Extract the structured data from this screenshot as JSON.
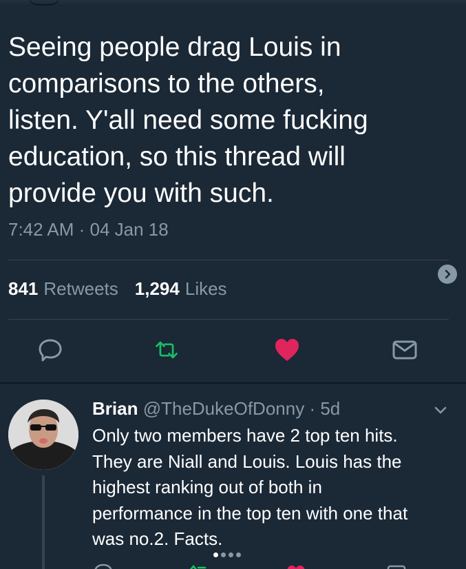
{
  "tweet": {
    "text": "Seeing people drag Louis in\ncomparisons to the others,\nlisten. Y'all need some fucking\neducation, so this thread will\nprovide you with such.",
    "timestamp": "7:42 AM · 04 Jan 18",
    "retweets_count": "841",
    "retweets_label": "Retweets",
    "likes_count": "1,294",
    "likes_label": "Likes"
  },
  "icons": {
    "reply": "speech-bubble-icon",
    "retweet": "retweet-icon",
    "like": "heart-icon",
    "dm": "envelope-icon",
    "expand": "chevron-right-icon"
  },
  "colors": {
    "background": "#1b2836",
    "secondary_text": "#8899a6",
    "retweet_green": "#17bf63",
    "like_red": "#e0245e",
    "divider": "#38444d"
  },
  "reply": {
    "name": "Brian",
    "handle": "@TheDukeOfDonny",
    "age": "· 5d",
    "text": "Only two members have 2 top ten hits.\nThey are Niall and Louis. Louis has the\nhighest ranking out of both in\nperformance in the top ten with one that\nwas no.2. Facts."
  }
}
